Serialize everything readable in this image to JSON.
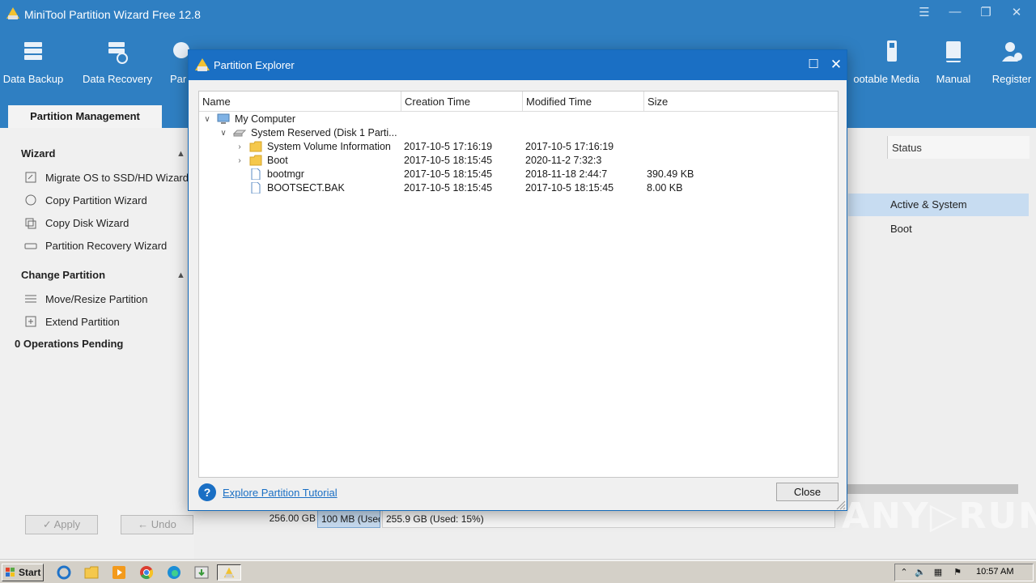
{
  "app": {
    "title": "MiniTool Partition Wizard Free 12.8",
    "window_controls": [
      "☰",
      "—",
      "❐",
      "✕"
    ]
  },
  "toolbar": {
    "items": [
      {
        "label": "Data Backup",
        "icon": "data-backup-icon"
      },
      {
        "label": "Data Recovery",
        "icon": "data-recovery-icon"
      },
      {
        "label": "Par",
        "icon": "partition-recovery-icon"
      },
      {
        "label": "ootable Media",
        "icon": "bootable-media-icon"
      },
      {
        "label": "Manual",
        "icon": "manual-icon"
      },
      {
        "label": "Register",
        "icon": "register-icon"
      }
    ]
  },
  "tabs": {
    "active": "Partition Management"
  },
  "sidebar": {
    "wizard_header": "Wizard",
    "wizard_items": [
      "Migrate OS to SSD/HD Wizard",
      "Copy Partition Wizard",
      "Copy Disk Wizard",
      "Partition Recovery Wizard"
    ],
    "change_header": "Change Partition",
    "change_items": [
      "Move/Resize Partition",
      "Extend Partition"
    ],
    "pending": "0 Operations Pending",
    "apply_label": "✓ Apply",
    "undo_label": "← Undo"
  },
  "main": {
    "status_header": "Status",
    "status_rows": [
      "Active & System",
      "Boot"
    ],
    "disk": {
      "size": "256.00 GB",
      "p1": "100 MB (Used",
      "p2": "255.9 GB (Used: 15%)"
    }
  },
  "dialog": {
    "title": "Partition Explorer",
    "columns": {
      "name": "Name",
      "ctime": "Creation Time",
      "mtime": "Modified Time",
      "size": "Size"
    },
    "rows": [
      {
        "name": "My Computer",
        "ctime": "",
        "mtime": "",
        "size": "",
        "level": 0,
        "expander": "expanded",
        "icon": "computer-icon"
      },
      {
        "name": "System Reserved (Disk 1 Parti...",
        "ctime": "",
        "mtime": "",
        "size": "",
        "level": 1,
        "expander": "expanded",
        "icon": "drive-icon"
      },
      {
        "name": "System Volume Information",
        "ctime": "2017-10-5 17:16:19",
        "mtime": "2017-10-5 17:16:19",
        "size": "",
        "level": 2,
        "expander": "collapsed",
        "icon": "folder-icon"
      },
      {
        "name": "Boot",
        "ctime": "2017-10-5 18:15:45",
        "mtime": "2020-11-2 7:32:3",
        "size": "",
        "level": 2,
        "expander": "collapsed",
        "icon": "folder-icon"
      },
      {
        "name": "bootmgr",
        "ctime": "2017-10-5 18:15:45",
        "mtime": "2018-11-18 2:44:7",
        "size": "390.49 KB",
        "level": 2,
        "expander": "none",
        "icon": "file-icon"
      },
      {
        "name": "BOOTSECT.BAK",
        "ctime": "2017-10-5 18:15:45",
        "mtime": "2017-10-5 18:15:45",
        "size": "8.00 KB",
        "level": 2,
        "expander": "none",
        "icon": "file-icon"
      }
    ],
    "help_link": "Explore Partition Tutorial",
    "close_label": "Close"
  },
  "watermark": "ANY▷RUN",
  "taskbar": {
    "start_label": "Start",
    "clock": "10:57 AM",
    "apps": [
      "ie-icon",
      "explorer-icon",
      "media-player-icon",
      "chrome-icon",
      "edge-icon",
      "install-icon",
      "partition-wizard-icon"
    ]
  },
  "colors": {
    "accent": "#2f7fc2",
    "dialog_titlebar": "#1a6fc4",
    "selection": "#c7dcf1",
    "link": "#1a6fc4"
  }
}
